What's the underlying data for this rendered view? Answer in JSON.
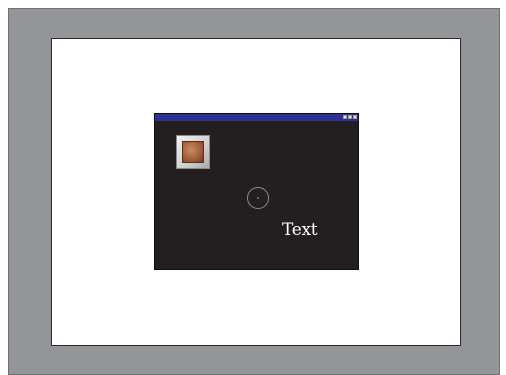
{
  "canvas": {
    "text_widget": "Text",
    "icons": {
      "image_widget": "picture-icon",
      "target_widget": "crosshair-icon",
      "window_controls": [
        "minimize-icon",
        "maximize-icon",
        "close-icon"
      ]
    }
  },
  "colors": {
    "frame": "#939598",
    "page": "#ffffff",
    "screen": "#231f20",
    "titlebar": "#2e3192",
    "text": "#ffffff"
  }
}
